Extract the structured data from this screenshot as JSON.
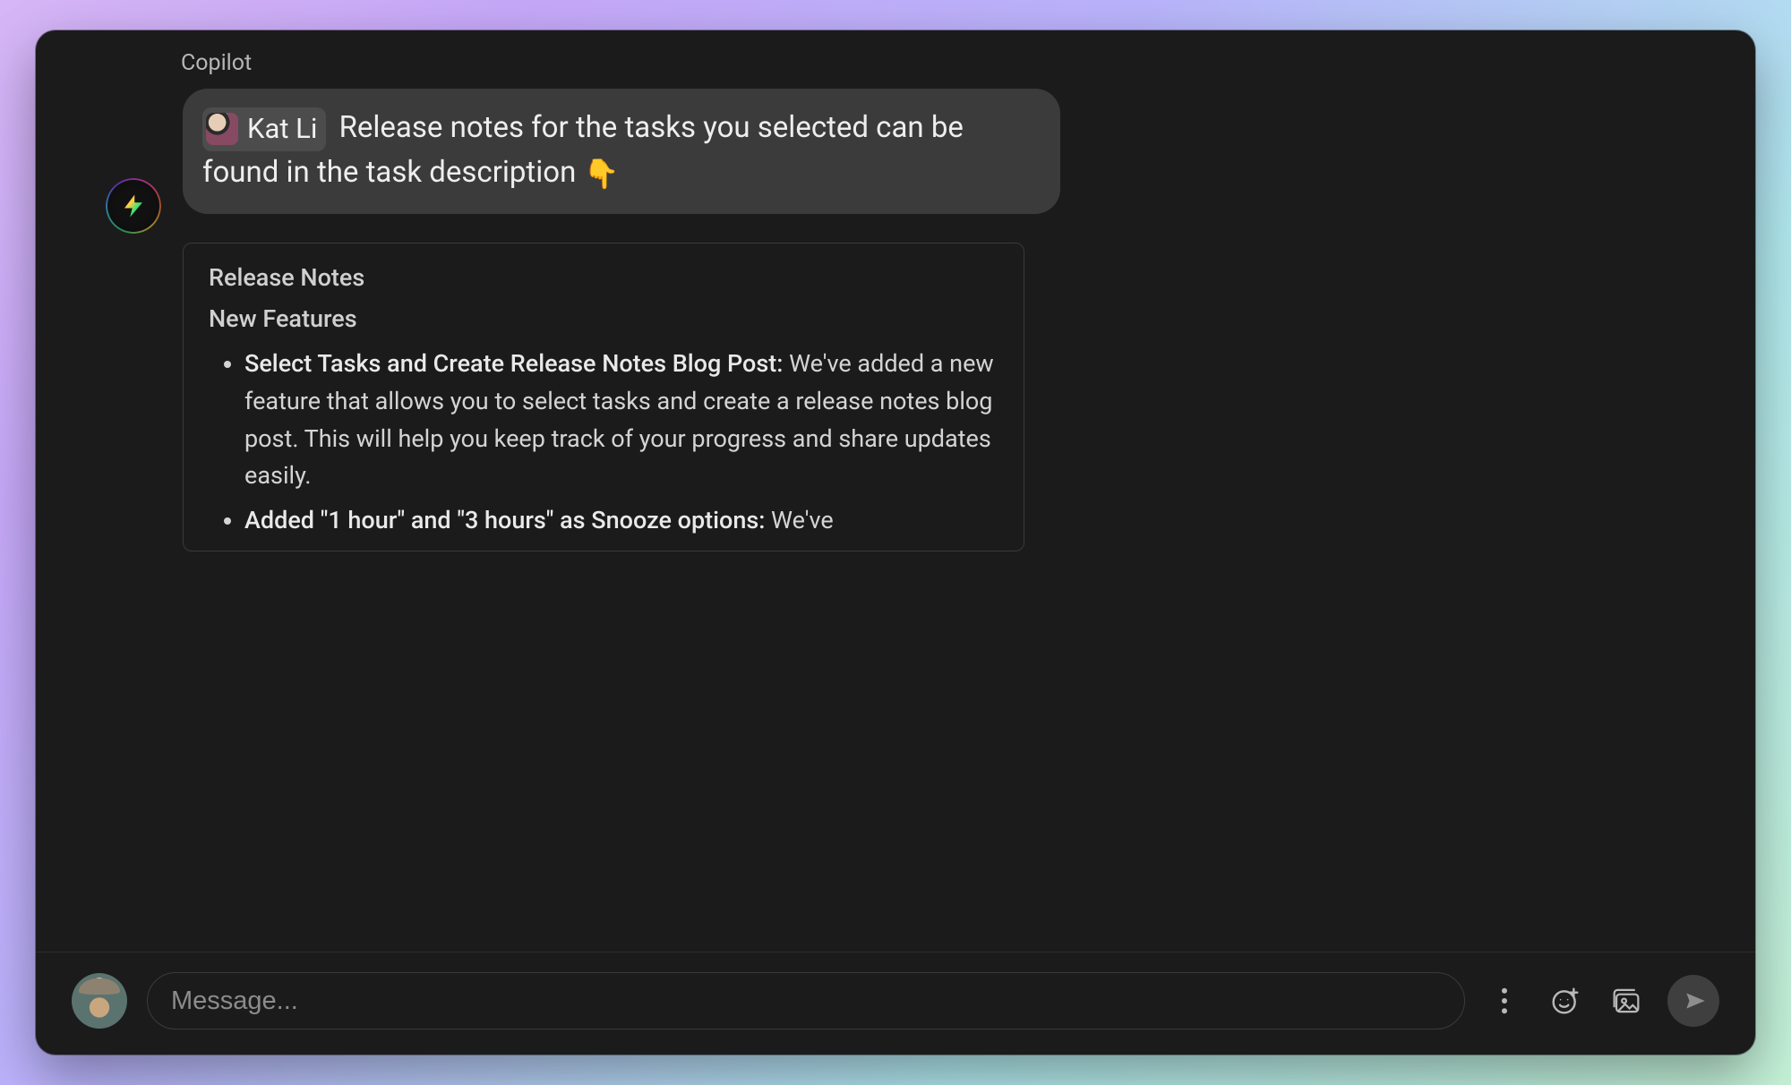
{
  "sender": "Copilot",
  "message": {
    "mention": {
      "name": "Kat Li"
    },
    "text_before": "",
    "text_after_mention": " Release notes for the tasks you selected can be found in the task description ",
    "emoji": "👇"
  },
  "notes": {
    "heading1": "Release Notes",
    "heading2": "New Features",
    "items": [
      {
        "title": "Select Tasks and Create Release Notes Blog Post:",
        "body": " We've added a new feature that allows you to select tasks and create a release notes blog post. This will help you keep track of your progress and share updates easily."
      },
      {
        "title": "Added \"1 hour\" and \"3 hours\" as Snooze options:",
        "body": " We've"
      }
    ]
  },
  "composer": {
    "placeholder": "Message..."
  }
}
